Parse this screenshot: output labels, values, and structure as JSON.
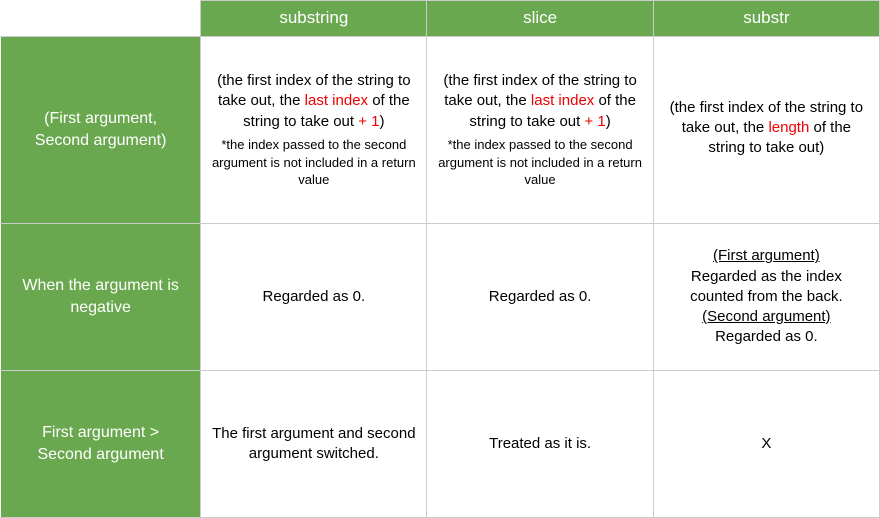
{
  "headers": {
    "col1": "substring",
    "col2": "slice",
    "col3": "substr"
  },
  "rows": {
    "args": {
      "label": "(First argument, Second argument)",
      "substring": {
        "pre": "(the first index of the string to take out, the ",
        "red1": "last index",
        "mid": " of the string to take out ",
        "red2": "+ 1",
        "post": ")",
        "note": "*the index passed to the second argument is not included in a return value"
      },
      "slice": {
        "pre": "(the first index of the string to take out, the ",
        "red1": "last index",
        "mid": " of the string to take out ",
        "red2": "+ 1",
        "post": ")",
        "note": "*the index passed to the second argument is not included in a return value"
      },
      "substr": {
        "pre": "(the first index of the string to take out, the ",
        "red1": "length",
        "mid": " of the string to take out)",
        "red2": "",
        "post": "",
        "note": ""
      }
    },
    "neg": {
      "label": "When the argument is negative",
      "substring": "Regarded as 0.",
      "slice": "Regarded as 0.",
      "substr": {
        "h1": "(First argument)",
        "l1": "Regarded as the index counted from the back.",
        "h2": "(Second argument)",
        "l2": "Regarded as 0."
      }
    },
    "gt": {
      "label": "First argument > Second argument",
      "substring": "The first argument and second argument switched.",
      "slice": "Treated as it is.",
      "substr": "X"
    }
  }
}
